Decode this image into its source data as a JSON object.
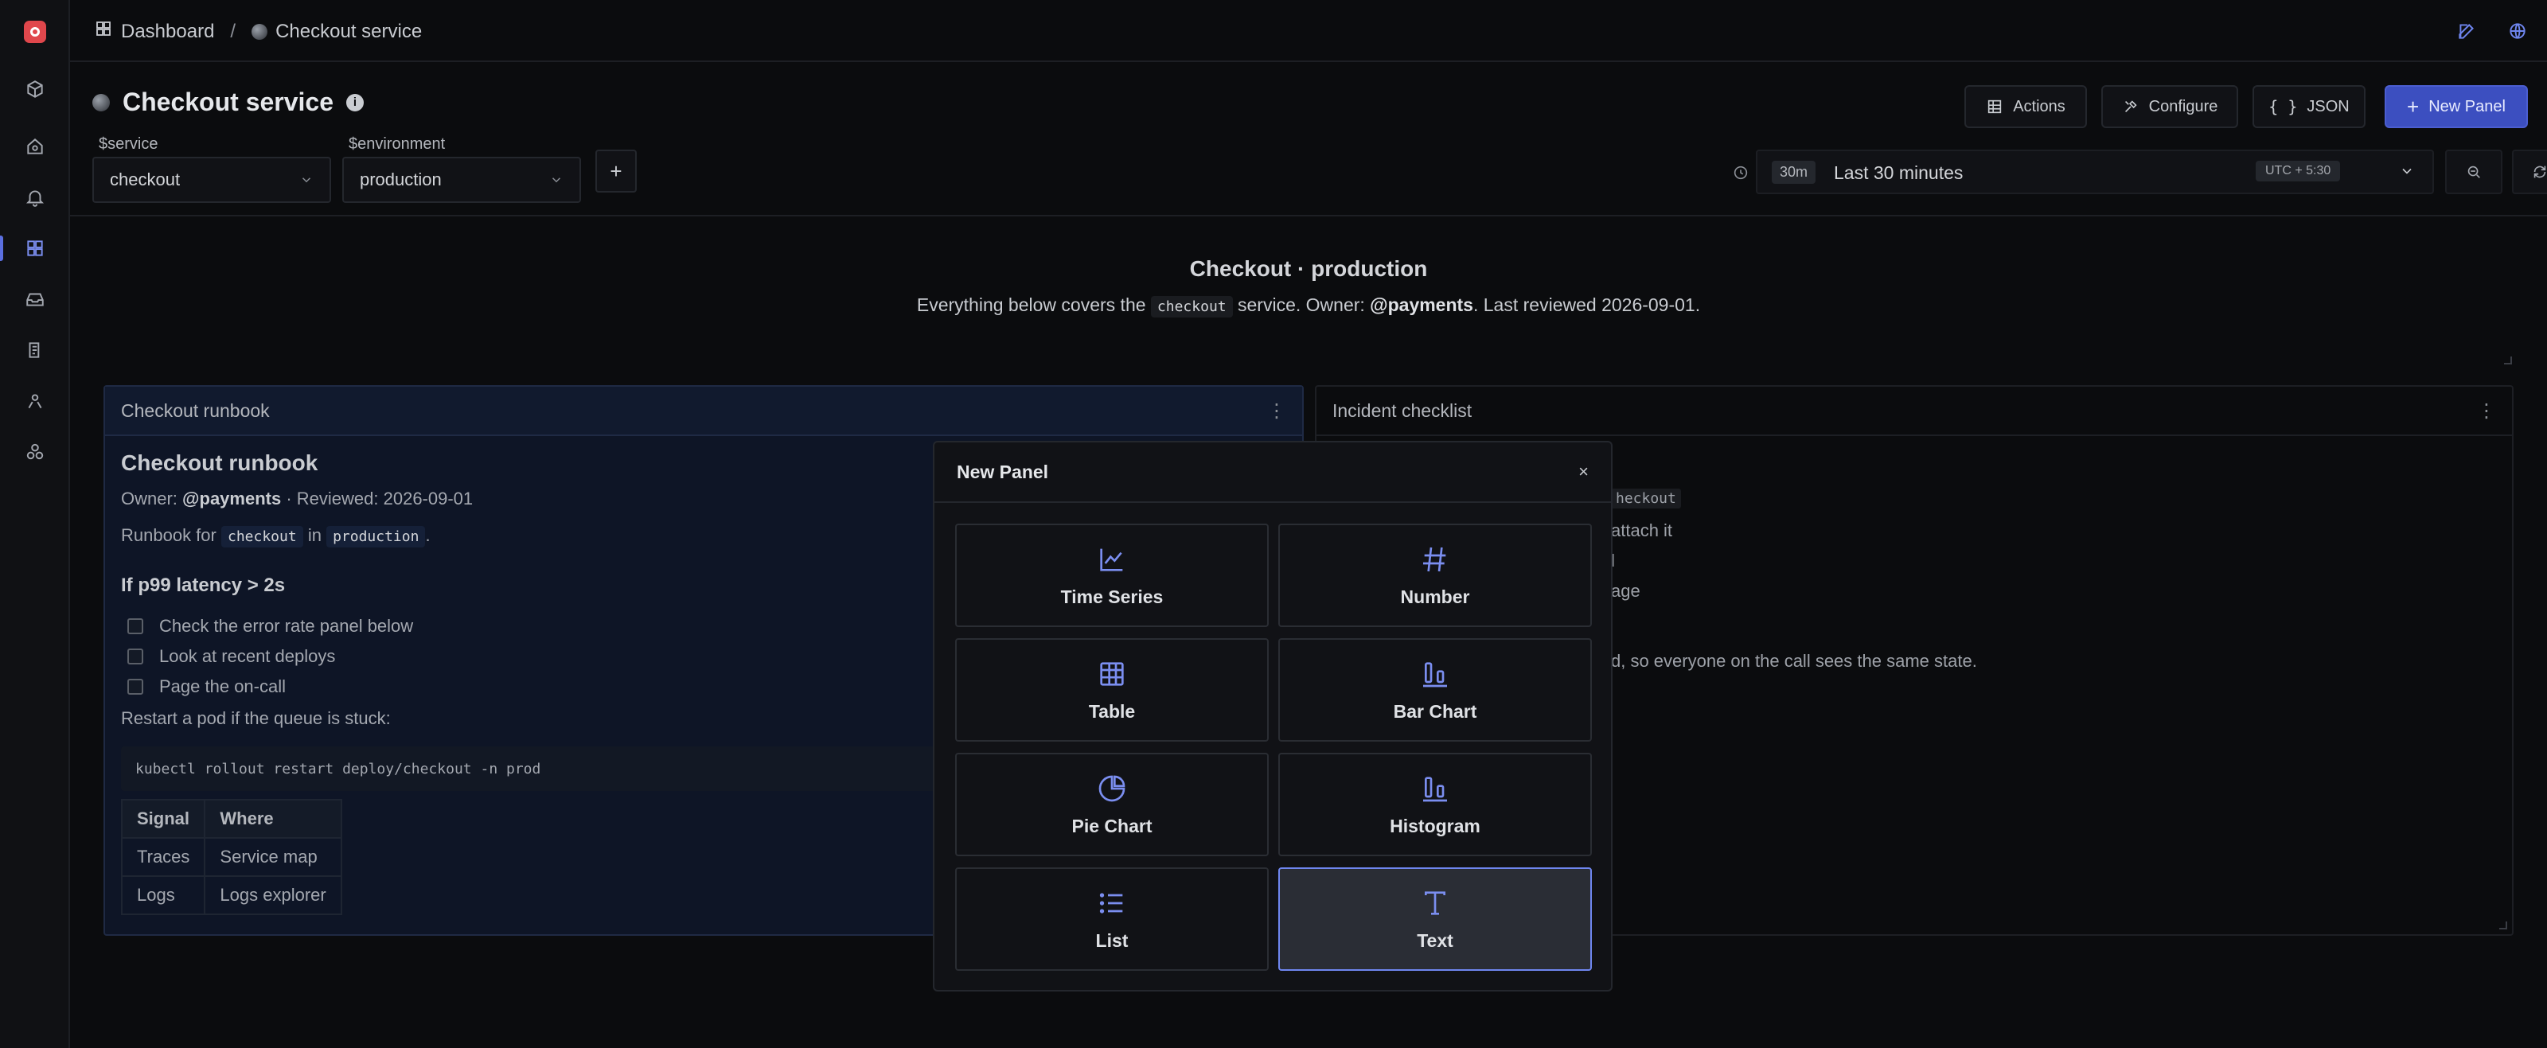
{
  "breadcrumb": {
    "root": "Dashboard",
    "separator": "/",
    "current": "Checkout service"
  },
  "header": {
    "title": "Checkout service",
    "buttons": {
      "actions": "Actions",
      "configure": "Configure",
      "json": "JSON",
      "new_panel": "New Panel"
    }
  },
  "variables": [
    {
      "label": "$service",
      "value": "checkout"
    },
    {
      "label": "$environment",
      "value": "production"
    }
  ],
  "time": {
    "badge": "30m",
    "range": "Last 30 minutes",
    "timezone": "UTC + 5:30"
  },
  "dashboard_text": {
    "title": "Checkout · production",
    "sub_before": "Everything below covers the",
    "sub_code": "checkout",
    "sub_mid": "service. Owner:",
    "sub_owner": "@payments",
    "sub_after": ". Last reviewed 2026-09-01."
  },
  "runbook": {
    "panel_title": "Checkout runbook",
    "heading": "Checkout runbook",
    "owner_label": "Owner:",
    "owner": "@payments",
    "reviewed": "· Reviewed: 2026-09-01",
    "intro_before": "Runbook for",
    "intro_code1": "checkout",
    "intro_mid": "in",
    "intro_code2": "production",
    "intro_after": ".",
    "subheading": "If p99 latency > 2s",
    "checklist": [
      "Check the error rate panel below",
      "Look at recent deploys",
      "Page the on-call"
    ],
    "restart_text": "Restart a pod if the queue is stuck:",
    "command": "kubectl rollout restart deploy/checkout -n prod",
    "table": {
      "headers": [
        "Signal",
        "Where"
      ],
      "rows": [
        [
          "Traces",
          "Service map"
        ],
        [
          "Logs",
          "Logs explorer"
        ]
      ]
    }
  },
  "incident": {
    "panel_title": "Incident checklist",
    "fragment_code": "heckout",
    "fragment_1": "attach it",
    "fragment_2": "l",
    "fragment_3": "age",
    "fragment_4": "d, so everyone on the call sees the same state."
  },
  "modal": {
    "title": "New Panel",
    "close": "×",
    "types": [
      {
        "label": "Time Series",
        "icon": "line-chart-icon"
      },
      {
        "label": "Number",
        "icon": "hash-icon"
      },
      {
        "label": "Table",
        "icon": "table-icon"
      },
      {
        "label": "Bar Chart",
        "icon": "bar-chart-icon"
      },
      {
        "label": "Pie Chart",
        "icon": "pie-chart-icon"
      },
      {
        "label": "Histogram",
        "icon": "histogram-icon"
      },
      {
        "label": "List",
        "icon": "list-icon"
      },
      {
        "label": "Text",
        "icon": "text-icon"
      }
    ],
    "selected": "Text"
  },
  "colors": {
    "accent": "#5b6fe0",
    "primary_button": "#3c4fc0",
    "brand": "#e0474c",
    "icon_blue": "#7b8ef0"
  }
}
